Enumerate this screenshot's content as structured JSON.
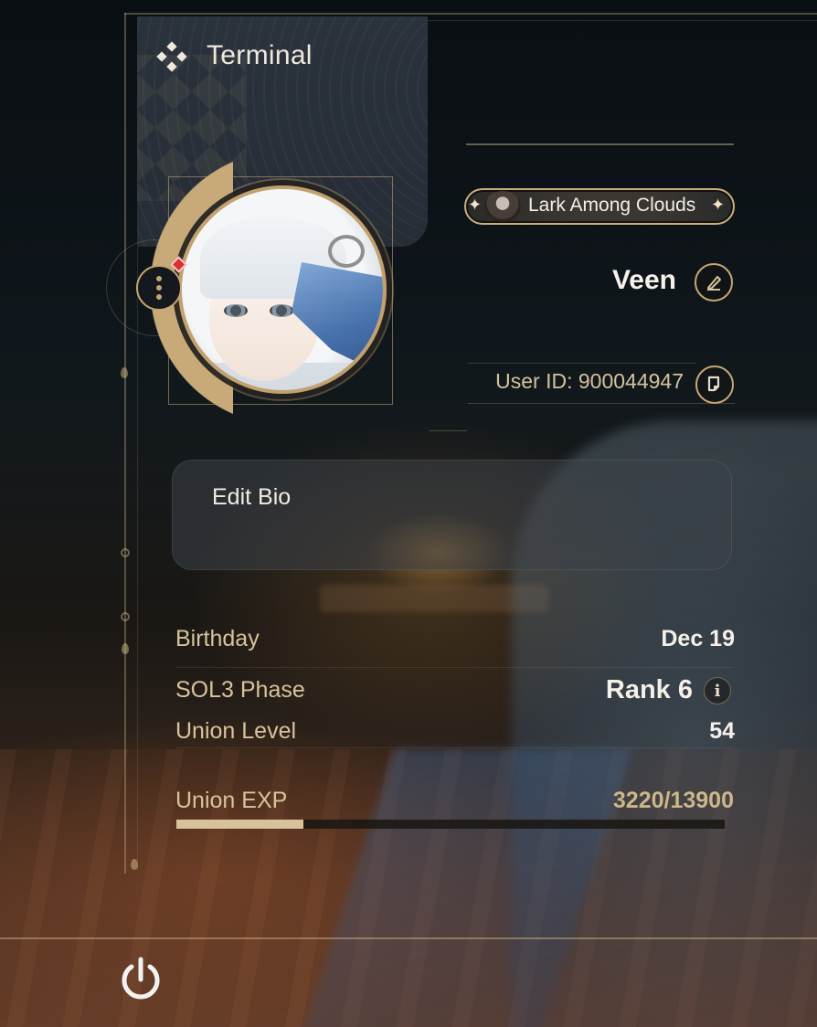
{
  "header": {
    "title": "Terminal",
    "icon": "terminal-diamond-icon"
  },
  "profile": {
    "title_chip": "Lark Among Clouds",
    "name": "Veen",
    "user_id": "User ID: 900044947",
    "edit_name_icon": "pencil-icon",
    "copy_id_icon": "copy-icon",
    "avatar_menu_icon": "more-vertical-icon",
    "has_notification": true
  },
  "bio": {
    "label": "Edit Bio"
  },
  "stats": [
    {
      "key": "birthday",
      "label": "Birthday",
      "value": "Dec 19"
    },
    {
      "key": "sol3",
      "label": "SOL3 Phase",
      "value": "Rank 6"
    },
    {
      "key": "union_level",
      "label": "Union Level",
      "value": "54"
    }
  ],
  "exp": {
    "label": "Union EXP",
    "value": "3220/13900",
    "current": 3220,
    "max": 13900
  },
  "footer": {
    "power_icon": "power-icon"
  },
  "colors": {
    "accent": "#c6a674",
    "label": "#d7c39c",
    "value": "#f4f0e8"
  }
}
